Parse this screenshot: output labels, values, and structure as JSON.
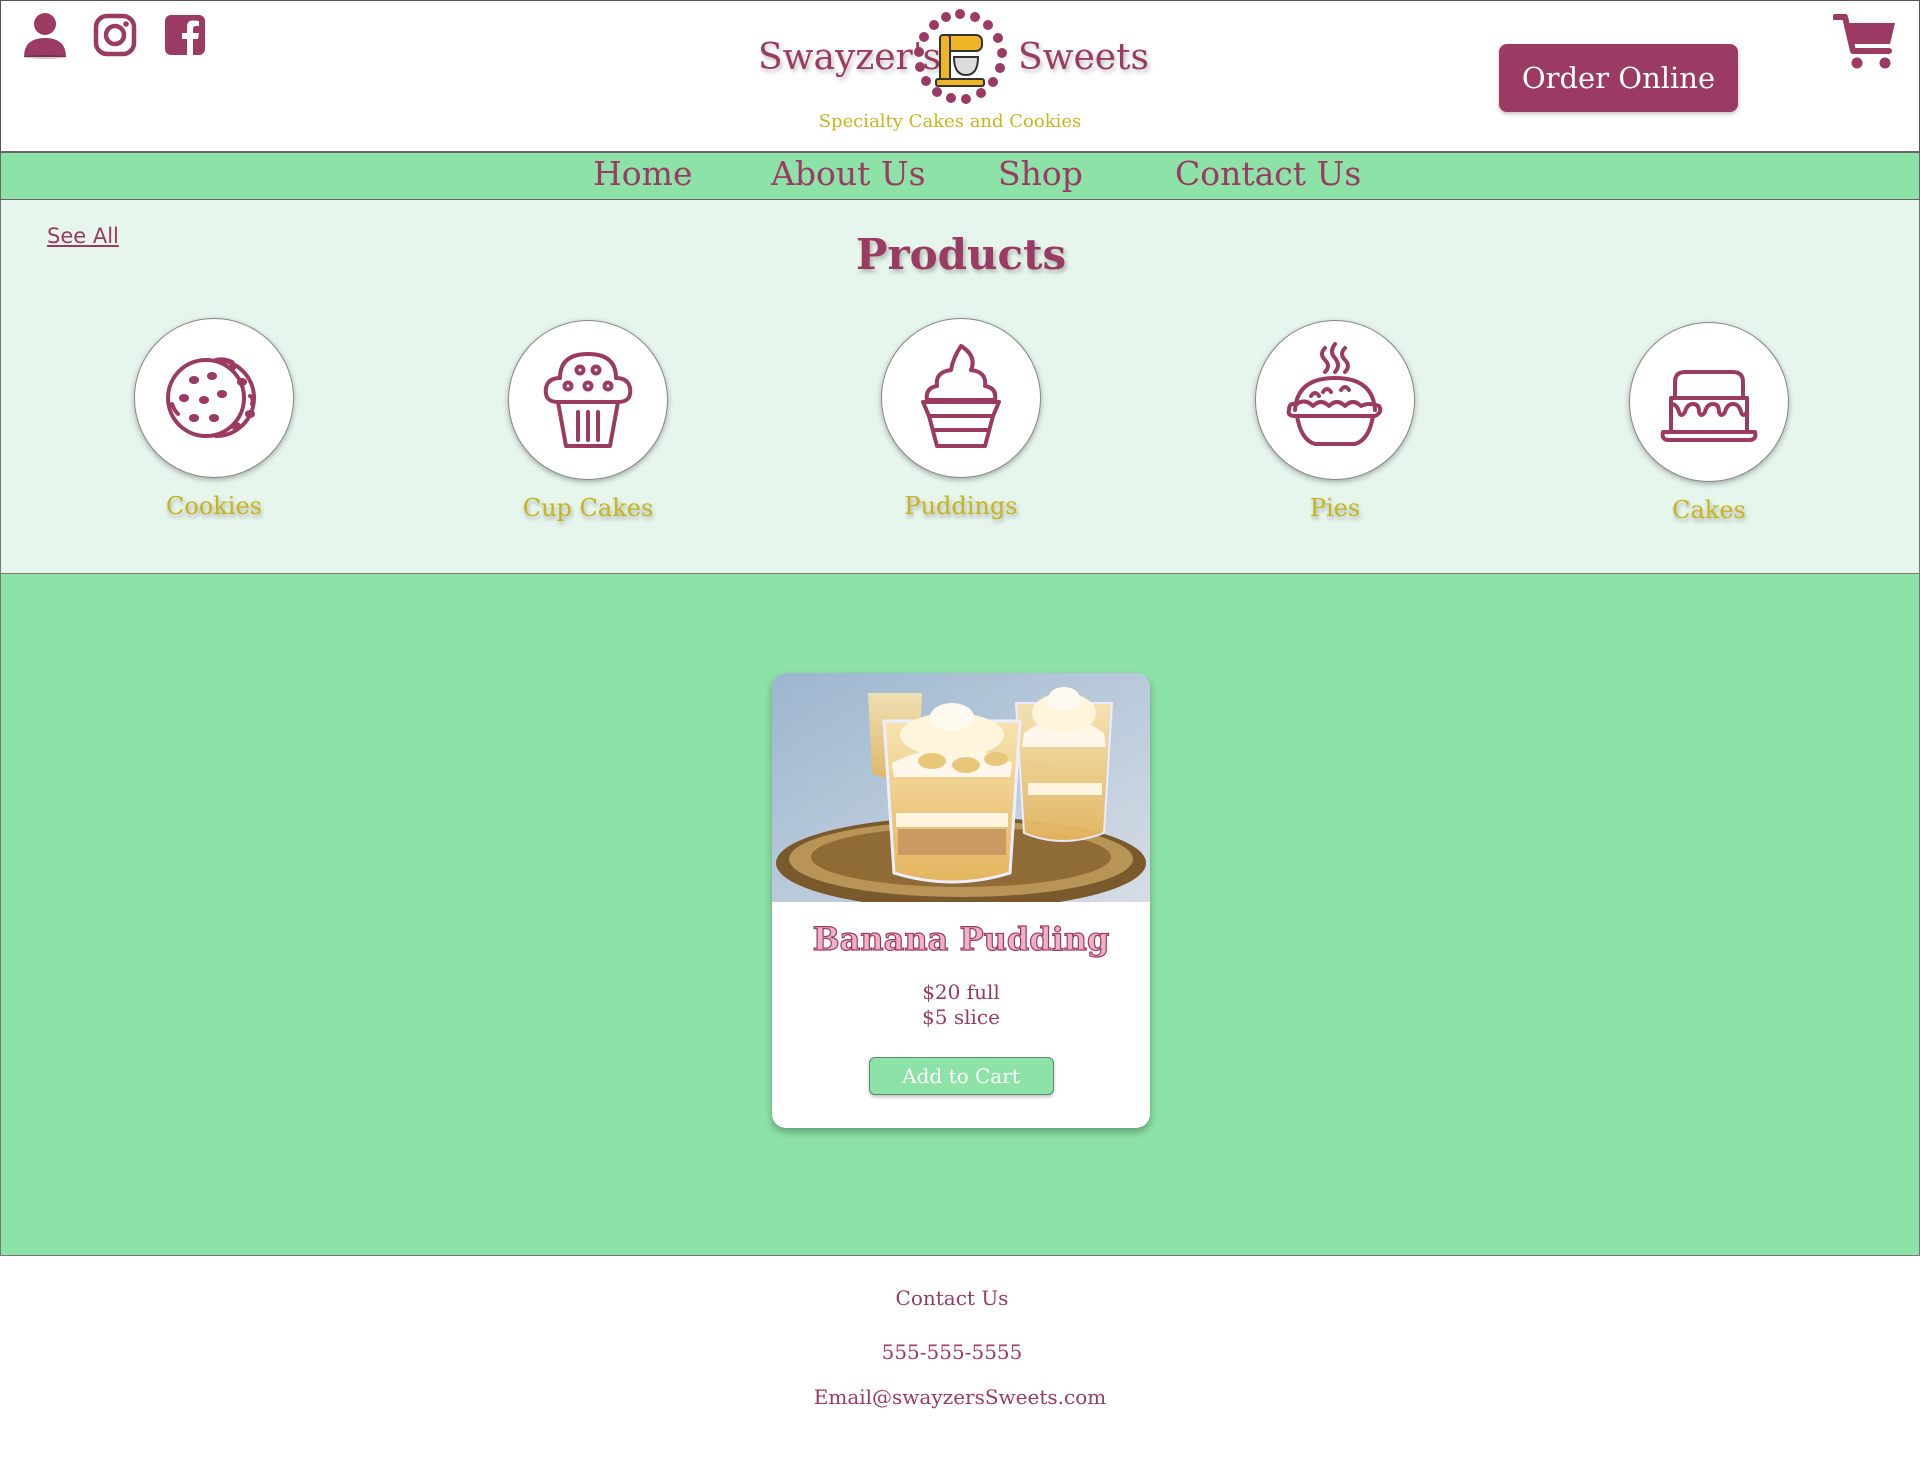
{
  "header": {
    "brand_left": "Swayzer's",
    "brand_right": "Sweets",
    "tagline": "Specialty Cakes and Cookies",
    "order_button": "Order Online",
    "social_icons": [
      "user-icon",
      "instagram-icon",
      "facebook-icon"
    ],
    "cart_icon": "shopping-cart-icon"
  },
  "nav": {
    "items": [
      {
        "label": "Home"
      },
      {
        "label": "About Us"
      },
      {
        "label": "Shop"
      },
      {
        "label": "Contact Us"
      }
    ]
  },
  "products": {
    "see_all": "See All",
    "title": "Products",
    "categories": [
      {
        "label": "Cookies",
        "icon": "cookies-icon"
      },
      {
        "label": "Cup Cakes",
        "icon": "cupcake-icon"
      },
      {
        "label": "Puddings",
        "icon": "pudding-icon"
      },
      {
        "label": "Pies",
        "icon": "pie-icon"
      },
      {
        "label": "Cakes",
        "icon": "cake-icon"
      }
    ]
  },
  "featured": {
    "title": "Banana Pudding",
    "price_full": "$20 full",
    "price_slice": "$5 slice",
    "add_button": "Add to Cart"
  },
  "footer": {
    "contact_heading": "Contact Us",
    "phone": "555-555-5555",
    "email": "Email@swayzersSweets.com"
  },
  "colors": {
    "brand": "#9b3a62",
    "accent_green": "#8de2a8",
    "light_green": "#e6f6ec",
    "gold": "#c9b41e"
  }
}
